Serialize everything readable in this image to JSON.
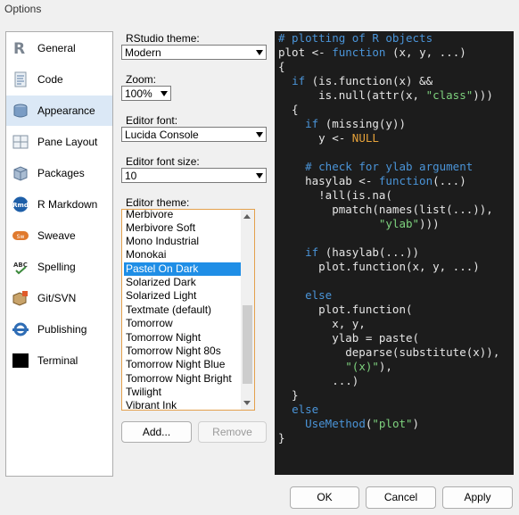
{
  "window": {
    "title": "Options"
  },
  "sidebar": {
    "items": [
      {
        "label": "General",
        "icon": "r-logo-icon",
        "selected": false
      },
      {
        "label": "Code",
        "icon": "code-page-icon",
        "selected": false
      },
      {
        "label": "Appearance",
        "icon": "paint-bucket-icon",
        "selected": true
      },
      {
        "label": "Pane Layout",
        "icon": "pane-grid-icon",
        "selected": false
      },
      {
        "label": "Packages",
        "icon": "package-box-icon",
        "selected": false
      },
      {
        "label": "R Markdown",
        "icon": "rmd-icon",
        "selected": false
      },
      {
        "label": "Sweave",
        "icon": "sweave-icon",
        "selected": false
      },
      {
        "label": "Spelling",
        "icon": "spellcheck-icon",
        "selected": false
      },
      {
        "label": "Git/SVN",
        "icon": "git-svn-icon",
        "selected": false
      },
      {
        "label": "Publishing",
        "icon": "publishing-icon",
        "selected": false
      },
      {
        "label": "Terminal",
        "icon": "terminal-icon",
        "selected": false
      }
    ]
  },
  "appearance": {
    "rstudio_theme": {
      "label": "RStudio theme:",
      "value": "Modern"
    },
    "zoom": {
      "label": "Zoom:",
      "value": "100%"
    },
    "editor_font": {
      "label": "Editor font:",
      "value": "Lucida Console"
    },
    "editor_font_size": {
      "label": "Editor font size:",
      "value": "10"
    },
    "editor_theme": {
      "label": "Editor theme:",
      "items": [
        "Merbivore",
        "Merbivore Soft",
        "Mono Industrial",
        "Monokai",
        "Pastel On Dark",
        "Solarized Dark",
        "Solarized Light",
        "Textmate (default)",
        "Tomorrow",
        "Tomorrow Night",
        "Tomorrow Night 80s",
        "Tomorrow Night Blue",
        "Tomorrow Night Bright",
        "Twilight",
        "Vibrant Ink"
      ],
      "selected": "Pastel On Dark"
    },
    "add_button": "Add...",
    "remove_button": "Remove"
  },
  "preview": {
    "lines": [
      [
        [
          "comment",
          "# plotting of R objects"
        ]
      ],
      [
        [
          "plain",
          "plot <- "
        ],
        [
          "kw",
          "function"
        ],
        [
          "plain",
          " (x, y, ...)"
        ]
      ],
      [
        [
          "plain",
          "{"
        ]
      ],
      [
        [
          "plain",
          "  "
        ],
        [
          "kw",
          "if"
        ],
        [
          "plain",
          " (is.function(x) &&"
        ]
      ],
      [
        [
          "plain",
          "      is.null(attr(x, "
        ],
        [
          "str",
          "\"class\""
        ],
        [
          "plain",
          ")))"
        ]
      ],
      [
        [
          "plain",
          "  {"
        ]
      ],
      [
        [
          "plain",
          "    "
        ],
        [
          "kw",
          "if"
        ],
        [
          "plain",
          " (missing(y))"
        ]
      ],
      [
        [
          "plain",
          "      y <- "
        ],
        [
          "null",
          "NULL"
        ]
      ],
      [
        [
          "plain",
          ""
        ]
      ],
      [
        [
          "plain",
          "    "
        ],
        [
          "comment",
          "# check for ylab argument"
        ]
      ],
      [
        [
          "plain",
          "    hasylab <- "
        ],
        [
          "kw",
          "function"
        ],
        [
          "plain",
          "(...)"
        ]
      ],
      [
        [
          "plain",
          "      !all(is.na("
        ]
      ],
      [
        [
          "plain",
          "        pmatch(names(list(...)),"
        ]
      ],
      [
        [
          "plain",
          "               "
        ],
        [
          "str",
          "\"ylab\""
        ],
        [
          "plain",
          ")))"
        ]
      ],
      [
        [
          "plain",
          ""
        ]
      ],
      [
        [
          "plain",
          "    "
        ],
        [
          "kw",
          "if"
        ],
        [
          "plain",
          " (hasylab(...))"
        ]
      ],
      [
        [
          "plain",
          "      plot.function(x, y, ...)"
        ]
      ],
      [
        [
          "plain",
          ""
        ]
      ],
      [
        [
          "plain",
          "    "
        ],
        [
          "kw",
          "else"
        ]
      ],
      [
        [
          "plain",
          "      plot.function("
        ]
      ],
      [
        [
          "plain",
          "        x, y,"
        ]
      ],
      [
        [
          "plain",
          "        ylab = paste("
        ]
      ],
      [
        [
          "plain",
          "          deparse(substitute(x)),"
        ]
      ],
      [
        [
          "plain",
          "          "
        ],
        [
          "str",
          "\"(x)\""
        ],
        [
          "plain",
          "),"
        ]
      ],
      [
        [
          "plain",
          "        ...)"
        ]
      ],
      [
        [
          "plain",
          "  }"
        ]
      ],
      [
        [
          "plain",
          "  "
        ],
        [
          "kw",
          "else"
        ]
      ],
      [
        [
          "plain",
          "    "
        ],
        [
          "kw",
          "UseMethod"
        ],
        [
          "plain",
          "("
        ],
        [
          "str",
          "\"plot\""
        ],
        [
          "plain",
          ")"
        ]
      ],
      [
        [
          "plain",
          "}"
        ]
      ]
    ]
  },
  "footer": {
    "ok": "OK",
    "cancel": "Cancel",
    "apply": "Apply"
  },
  "colors": {
    "selection": "#1f8ee6",
    "focus_border": "#e3a04c",
    "editor_bg": "#1c1c1c"
  }
}
